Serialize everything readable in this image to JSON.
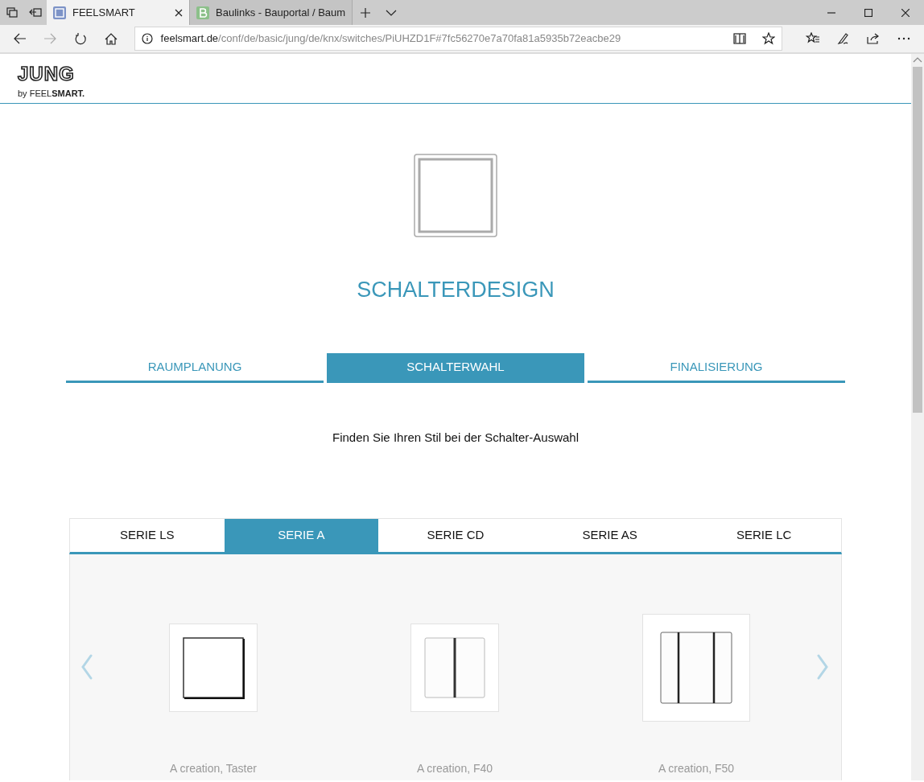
{
  "browser": {
    "tabs": [
      {
        "title": "FEELSMART",
        "selected": true
      },
      {
        "title": "Baulinks - Bauportal / Baum",
        "selected": false
      }
    ],
    "url_domain": "feelsmart.de",
    "url_path": "/conf/de/basic/jung/de/knx/switches/PiUHZD1F#7fc56270e7a70fa81a5935b72eacbe29"
  },
  "header": {
    "wordmark": "JUNG",
    "tagline": "by FEEL**SMART.**"
  },
  "title": "SCHALTERDESIGN",
  "steps": [
    {
      "label": "RAUMPLANUNG",
      "selected": false
    },
    {
      "label": "SCHALTERWAHL",
      "selected": true
    },
    {
      "label": "FINALISIERUNG",
      "selected": false
    }
  ],
  "subtitle": "Finden Sie Ihren Stil bei der Schalter-Auswahl",
  "series_tabs": [
    {
      "label": "SERIE LS",
      "selected": false
    },
    {
      "label": "SERIE A",
      "selected": true
    },
    {
      "label": "SERIE CD",
      "selected": false
    },
    {
      "label": "SERIE AS",
      "selected": false
    },
    {
      "label": "SERIE LC",
      "selected": false
    }
  ],
  "products": [
    {
      "name": "A creation, Taster",
      "kind": "rocker1"
    },
    {
      "name": "A creation, F40",
      "kind": "rocker2"
    },
    {
      "name": "A creation, F50",
      "kind": "rocker3"
    }
  ]
}
